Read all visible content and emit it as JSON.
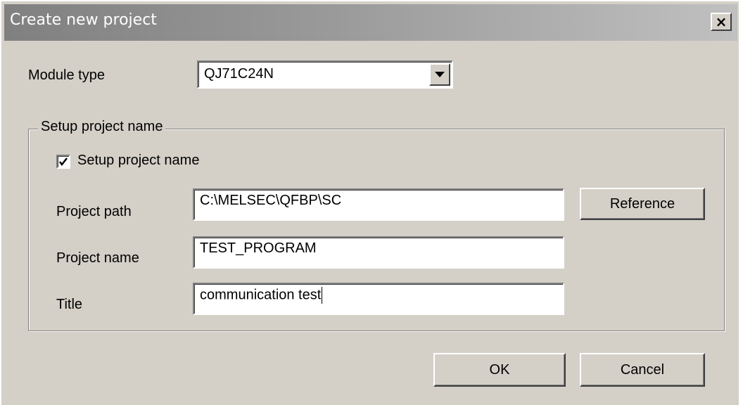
{
  "window": {
    "title": "Create new project",
    "close_icon": "close-x-icon",
    "close_label": "×"
  },
  "module_type": {
    "label": "Module type",
    "value": "QJ71C24N",
    "dropdown_icon": "chevron-down-icon"
  },
  "setup_group": {
    "legend": "Setup project name",
    "checkbox_label": "Setup project name",
    "checkbox_checked": true,
    "project_path": {
      "label": "Project path",
      "value": "C:\\MELSEC\\QFBP\\SC"
    },
    "project_name": {
      "label": "Project name",
      "value": "TEST_PROGRAM"
    },
    "title": {
      "label": "Title",
      "value": "communication test"
    },
    "reference_button": "Reference"
  },
  "buttons": {
    "ok": "OK",
    "cancel": "Cancel"
  },
  "colors": {
    "face": "#d4d0c8",
    "title_gradient_start": "#808080",
    "title_gradient_end": "#c0c0c0"
  }
}
